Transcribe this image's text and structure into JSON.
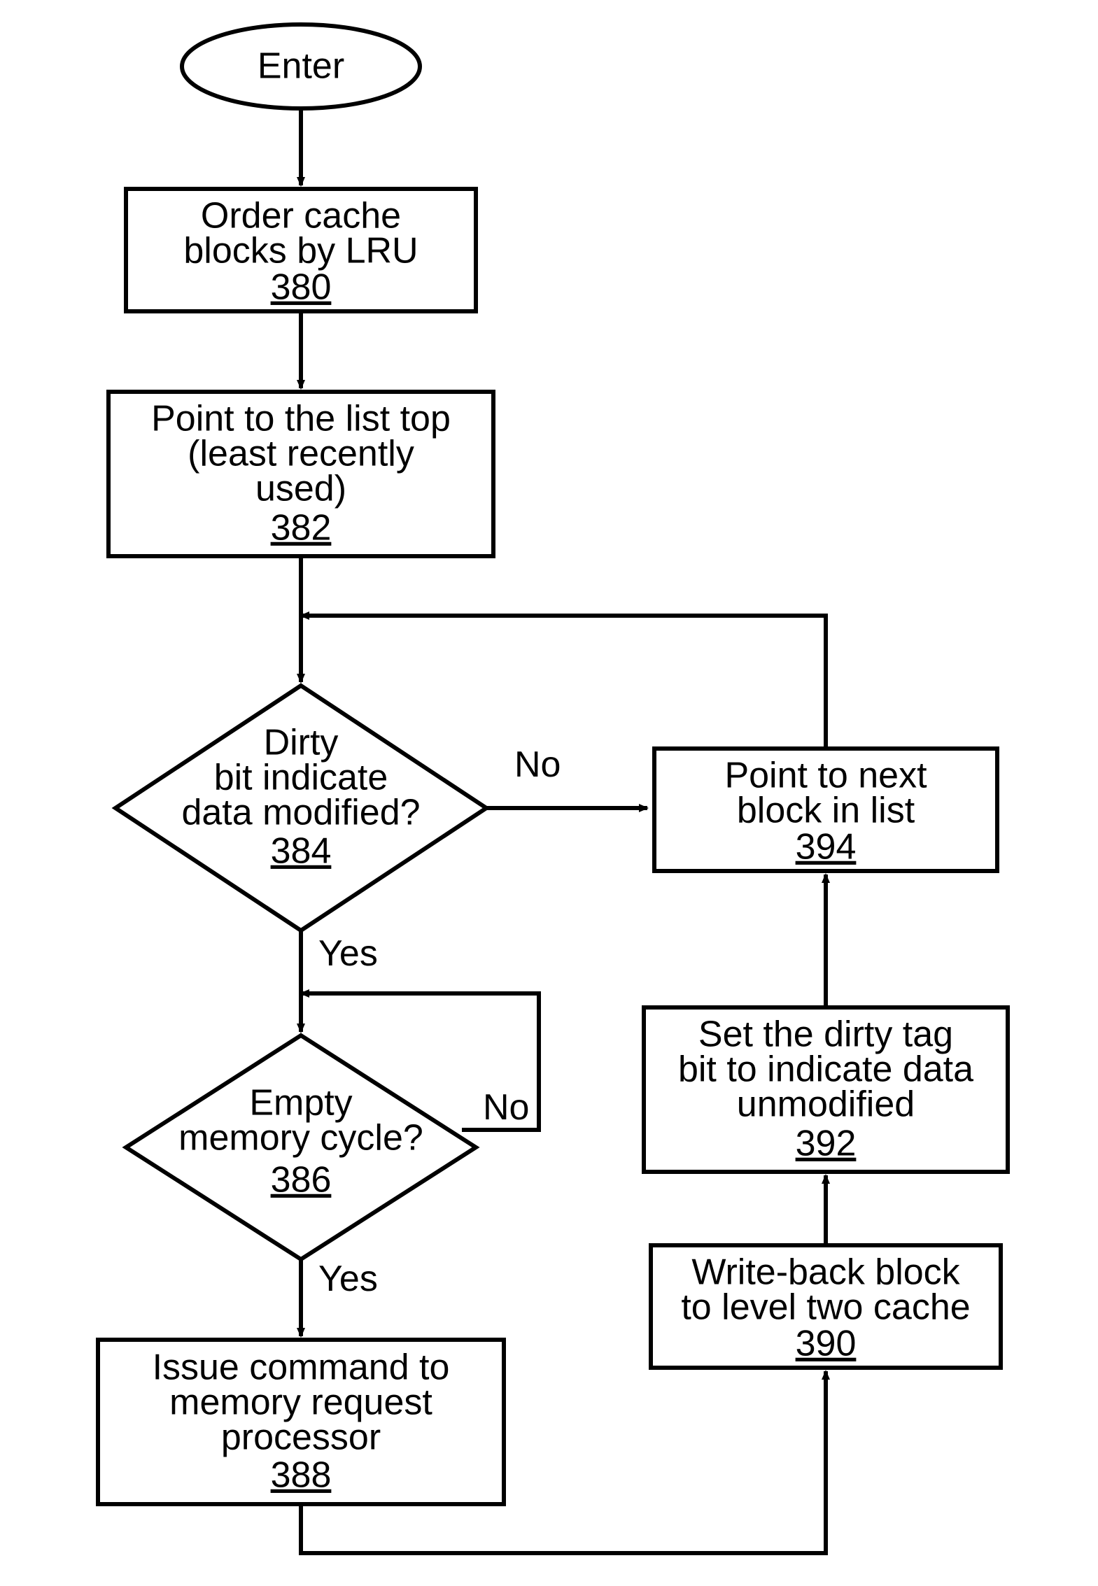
{
  "nodes": {
    "enter": {
      "label": "Enter"
    },
    "n380": {
      "l1": "Order cache",
      "l2": "blocks by LRU",
      "ref": "380"
    },
    "n382": {
      "l1": "Point to the list top",
      "l2": "(least recently",
      "l3": "used)",
      "ref": "382"
    },
    "n384": {
      "l1": "Dirty",
      "l2": "bit indicate",
      "l3": "data modified?",
      "ref": "384"
    },
    "n386": {
      "l1": "Empty",
      "l2": "memory cycle?",
      "ref": "386"
    },
    "n388": {
      "l1": "Issue command to",
      "l2": "memory request",
      "l3": "processor",
      "ref": "388"
    },
    "n390": {
      "l1": "Write-back block",
      "l2": "to level two cache",
      "ref": "390"
    },
    "n392": {
      "l1": "Set the dirty tag",
      "l2": "bit to indicate data",
      "l3": "unmodified",
      "ref": "392"
    },
    "n394": {
      "l1": "Point to next",
      "l2": "block in list",
      "ref": "394"
    }
  },
  "edgeLabels": {
    "no": "No",
    "yes": "Yes"
  }
}
